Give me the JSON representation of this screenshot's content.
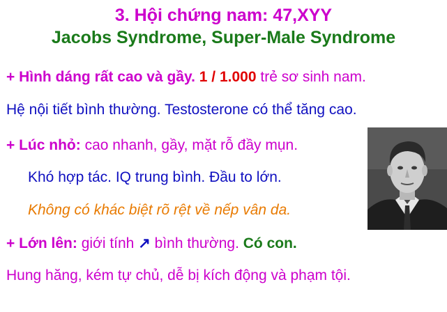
{
  "title": {
    "line1": "3. Hội chứng nam: 47,XYY",
    "line2": "Jacobs Syndrome, Super-Male Syndrome"
  },
  "line1": {
    "prefix": "+ Hình dáng rất cao và gầy.",
    "ratio": "1 / 1.000",
    "suffix": "trẻ sơ sinh nam."
  },
  "line2": {
    "text": "Hệ nội tiết bình thường. Testosterone có thể tăng cao."
  },
  "line3": {
    "prefix": "+ Lúc nhỏ:",
    "text": "cao nhanh, gầy, mặt rỗ đầy mụn."
  },
  "line4": {
    "text": "Khó hợp tác. IQ trung bình. Đầu to lớn."
  },
  "line5": {
    "text": "Không có khác biệt rõ rệt về nếp vân da."
  },
  "line6": {
    "prefix": "+ Lớn lên:",
    "text_a": "giới tính",
    "arrow": "↗",
    "text_b": "bình thường.",
    "tail": "Có con."
  },
  "line7": {
    "text": "Hung hăng, kém tự chủ, dễ bị kích động và phạm tội."
  },
  "colors": {
    "magenta": "#cc00cc",
    "green": "#1a7a1a",
    "red": "#e00000",
    "blue": "#1010c0",
    "orange": "#e87a00"
  }
}
